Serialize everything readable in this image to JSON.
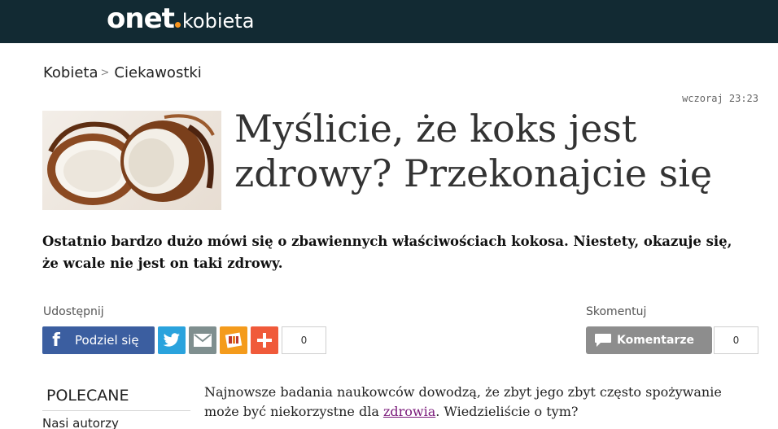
{
  "header": {
    "logo_main": "onet",
    "logo_sub": "kobieta",
    "brand_bg": "#122a33",
    "logo_dot_color": "#f7941d"
  },
  "breadcrumb": {
    "item1": "Kobieta",
    "separator": ">",
    "item2": "Ciekawostki"
  },
  "article": {
    "timestamp": "wczoraj 23:23",
    "title": "Myślicie, że koks jest zdrowy? Przekonajcie się",
    "lead": "Ostatnio bardzo dużo mówi się o zbawiennych właściwościach kokosa. Niestety, okazuje się, że wcale nie jest on taki zdrowy.",
    "body_before_link": "Najnowsze badania naukowców dowodzą, że zbyt jego zbyt często spożywanie może być niekorzystne dla ",
    "body_link": "zdrowia",
    "body_after_link": ". Wiedzieliście o tym?"
  },
  "share": {
    "label": "Udostępnij",
    "facebook_icon": "f",
    "facebook_label": "Podziel się",
    "count": "0",
    "icons": [
      "facebook-icon",
      "twitter-icon",
      "mail-icon",
      "wykop-icon",
      "plus-icon"
    ]
  },
  "comments": {
    "label": "Skomentuj",
    "button_label": "Komentarze",
    "count": "0"
  },
  "sidebar": {
    "heading": "POLECANE",
    "item1": "Nasi autorzy"
  }
}
